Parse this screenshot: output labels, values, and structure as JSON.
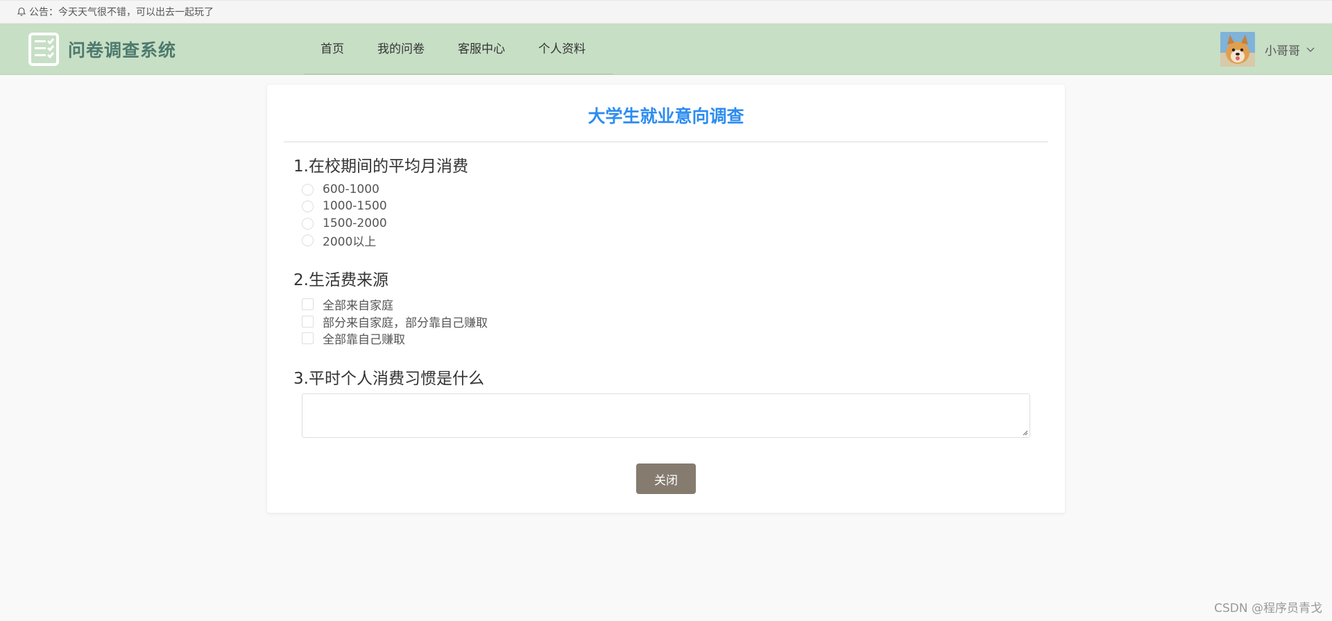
{
  "notice": {
    "text": "公告：今天天气很不错，可以出去一起玩了",
    "icon": "bell-icon"
  },
  "header": {
    "logo_icon": "clipboard-checklist-icon",
    "app_title": "问卷调查系统",
    "nav": [
      "首页",
      "我的问卷",
      "客服中心",
      "个人资料"
    ],
    "user_name": "小哥哥",
    "dropdown_icon": "chevron-down-icon",
    "colors": {
      "header_bg": "#c7dfc5",
      "logo_text": "#4e7a6e"
    }
  },
  "survey": {
    "title": "大学生就业意向调查",
    "title_color": "#2d8cf0",
    "questions": [
      {
        "title": "1.在校期间的平均月消费",
        "type": "radio",
        "options": [
          "600-1000",
          "1000-1500",
          "1500-2000",
          "2000以上"
        ]
      },
      {
        "title": "2.生活费来源",
        "type": "checkbox",
        "options": [
          "全部来自家庭",
          "部分来自家庭，部分靠自己赚取",
          "全部靠自己赚取"
        ]
      },
      {
        "title": "3.平时个人消费习惯是什么",
        "type": "textarea",
        "value": ""
      }
    ],
    "close_label": "关闭",
    "close_color": "#857b6f"
  },
  "watermark": "CSDN @程序员青戈"
}
